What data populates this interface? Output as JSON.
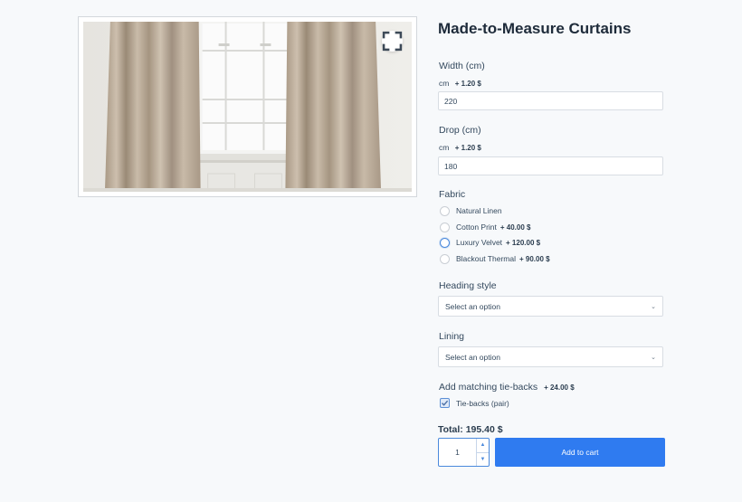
{
  "product": {
    "title": "Made-to-Measure Curtains",
    "image_alt": "Linen curtains framing a window",
    "zoom_icon": "fullscreen-icon"
  },
  "width": {
    "label": "Width (cm)",
    "unit": "cm",
    "price": "+ 1.20 $",
    "value": "220"
  },
  "drop": {
    "label": "Drop (cm)",
    "unit": "cm",
    "price": "+ 1.20 $",
    "value": "180"
  },
  "fabric": {
    "label": "Fabric",
    "selected": "Luxury Velvet",
    "options": [
      {
        "label": "Natural Linen",
        "price": ""
      },
      {
        "label": "Cotton Print",
        "price": "+ 40.00 $"
      },
      {
        "label": "Luxury Velvet",
        "price": "+ 120.00 $"
      },
      {
        "label": "Blackout Thermal",
        "price": "+ 90.00 $"
      }
    ]
  },
  "heading_style": {
    "label": "Heading style",
    "placeholder": "Select an option"
  },
  "lining": {
    "label": "Lining",
    "placeholder": "Select an option"
  },
  "tiebacks": {
    "label": "Add matching tie-backs",
    "price": "+ 24.00 $",
    "option_label": "Tie-backs (pair)",
    "checked": true
  },
  "total": {
    "text": "Total: 195.40 $"
  },
  "quantity": {
    "value": "1"
  },
  "cart": {
    "button_label": "Add to cart"
  },
  "colors": {
    "accent": "#2f7bf0",
    "text": "#2c3e50",
    "background": "#f7f9fb"
  }
}
